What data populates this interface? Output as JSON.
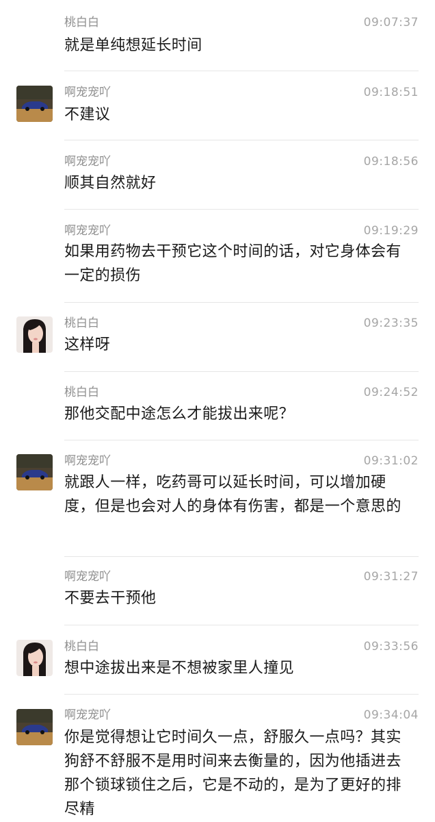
{
  "messages": [
    {
      "sender": "桃白白",
      "time": "09:07:37",
      "text": "就是单纯想延长时间",
      "avatar": "none"
    },
    {
      "sender": "啊宠宠吖",
      "time": "09:18:51",
      "text": "不建议",
      "avatar": "car-photo-avatar"
    },
    {
      "sender": "啊宠宠吖",
      "time": "09:18:56",
      "text": "顺其自然就好",
      "avatar": "none"
    },
    {
      "sender": "啊宠宠吖",
      "time": "09:19:29",
      "text": "如果用药物去干预它这个时间的话，对它身体会有一定的损伤",
      "avatar": "none"
    },
    {
      "sender": "桃白白",
      "time": "09:23:35",
      "text": "这样呀",
      "avatar": "woman-photo-avatar"
    },
    {
      "sender": "桃白白",
      "time": "09:24:52",
      "text": "那他交配中途怎么才能拔出来呢？",
      "avatar": "none"
    },
    {
      "sender": "啊宠宠吖",
      "time": "09:31:02",
      "text": "就跟人一样，吃药哥可以延长时间，可以增加硬度，但是也会对人的身体有伤害，都是一个意思的",
      "avatar": "car-photo-avatar"
    },
    {
      "sender": "啊宠宠吖",
      "time": "09:31:27",
      "text": "不要去干预他",
      "avatar": "none"
    },
    {
      "sender": "桃白白",
      "time": "09:33:56",
      "text": "想中途拔出来是不想被家里人撞见",
      "avatar": "woman-photo-avatar"
    },
    {
      "sender": "啊宠宠吖",
      "time": "09:34:04",
      "text": "你是觉得想让它时间久一点，舒服久一点吗？其实狗舒不舒服不是用时间来去衡量的，因为他插进去那个锁球锁住之后，它是不动的，是为了更好的排尽精",
      "avatar": "car-photo-avatar"
    }
  ]
}
